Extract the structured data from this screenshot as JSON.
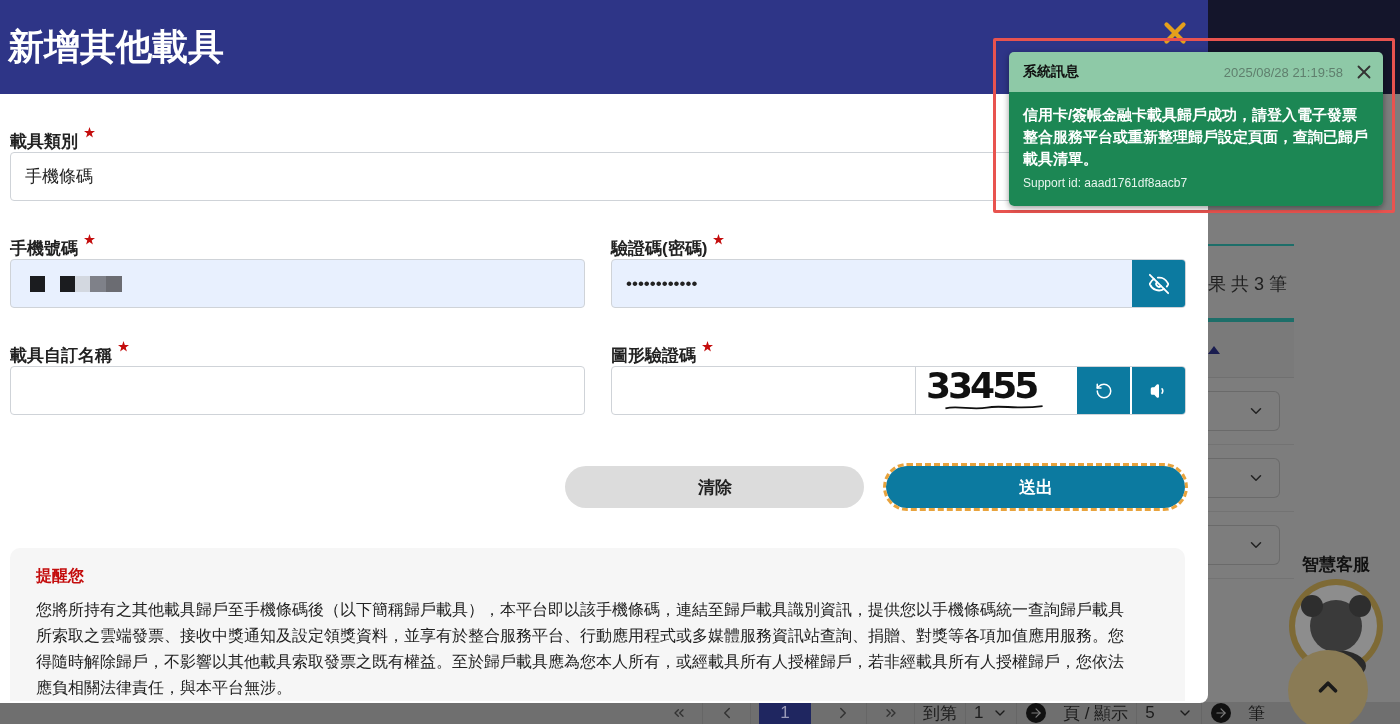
{
  "modal": {
    "title": "新增其他載具",
    "fields": [
      {
        "kind": "select",
        "label": "載具類別",
        "required": true,
        "value": "手機條碼"
      },
      {
        "kind": "masked",
        "label": "手機號碼",
        "required": true
      },
      {
        "kind": "password",
        "label": "驗證碼(密碼)",
        "required": true,
        "value": "••••••••••••",
        "revealed": false
      },
      {
        "kind": "text",
        "label": "載具自訂名稱",
        "required": true
      },
      {
        "kind": "captcha",
        "label": "圖形驗證碼",
        "required": true,
        "captcha": "33455"
      }
    ],
    "buttons": [
      {
        "label": "清除",
        "kind": "secondary",
        "focused": false
      },
      {
        "label": "送出",
        "kind": "primary",
        "focused": true
      }
    ],
    "notice": {
      "title": "提醒您",
      "text": "您將所持有之其他載具歸戶至手機條碼後（以下簡稱歸戶載具），本平台即以該手機條碼，連結至歸戶載具識別資訊，提供您以手機條碼統一查詢歸戶載具所索取之雲端發票、接收中獎通知及設定領獎資料，並享有於整合服務平台、行動應用程式或多媒體服務資訊站查詢、捐贈、對獎等各項加值應用服務。您得隨時解除歸戶，不影響以其他載具索取發票之既有權益。至於歸戶載具應為您本人所有，或經載具所有人授權歸戶，若非經載具所有人授權歸戶，您依法應負相關法律責任，與本平台無涉。"
    }
  },
  "background": {
    "result_count": "果 共 3 筆"
  },
  "pagination": {
    "current_page": "1",
    "goto_label": "到第",
    "goto_page": "1",
    "per_page_label": "頁 / 顯示",
    "per_page": "5",
    "unit": "筆"
  },
  "chatbot": {
    "label": "智慧客服"
  },
  "toast": {
    "title": "系統訊息",
    "time": "2025/08/28 21:19:58",
    "message": "信用卡/簽帳金融卡載具歸戶成功，請登入電子發票整合服務平台或重新整理歸戶設定頁面，查詢已歸戶載具清單。",
    "support_id": "Support id: aaad1761df8aacb7"
  }
}
